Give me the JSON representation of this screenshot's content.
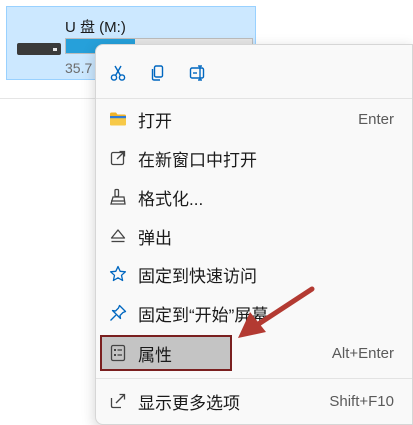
{
  "drive": {
    "name": "U 盘 (M:)",
    "free_text": "35.7",
    "used_fraction": 0.37
  },
  "menu": {
    "quick_actions": [
      {
        "icon": "cut-icon"
      },
      {
        "icon": "copy-icon"
      },
      {
        "icon": "rename-icon"
      }
    ],
    "items": [
      {
        "label": "打开",
        "shortcut": "Enter",
        "icon": "folder-icon"
      },
      {
        "label": "在新窗口中打开",
        "shortcut": "",
        "icon": "open-new-window-icon"
      },
      {
        "label": "格式化...",
        "shortcut": "",
        "icon": "format-icon"
      },
      {
        "label": "弹出",
        "shortcut": "",
        "icon": "eject-icon"
      },
      {
        "label": "固定到快速访问",
        "shortcut": "",
        "icon": "star-icon"
      },
      {
        "label": "固定到“开始”屏幕",
        "shortcut": "",
        "icon": "pin-icon"
      },
      {
        "label": "属性",
        "shortcut": "Alt+Enter",
        "icon": "properties-icon"
      },
      {
        "label": "显示更多选项",
        "shortcut": "Shift+F10",
        "icon": "more-options-icon"
      }
    ]
  },
  "colors": {
    "accent": "#0067c0",
    "folder": "#f0b429",
    "highlight_border": "#7a1f1f",
    "annotation_arrow": "#b33a32"
  }
}
